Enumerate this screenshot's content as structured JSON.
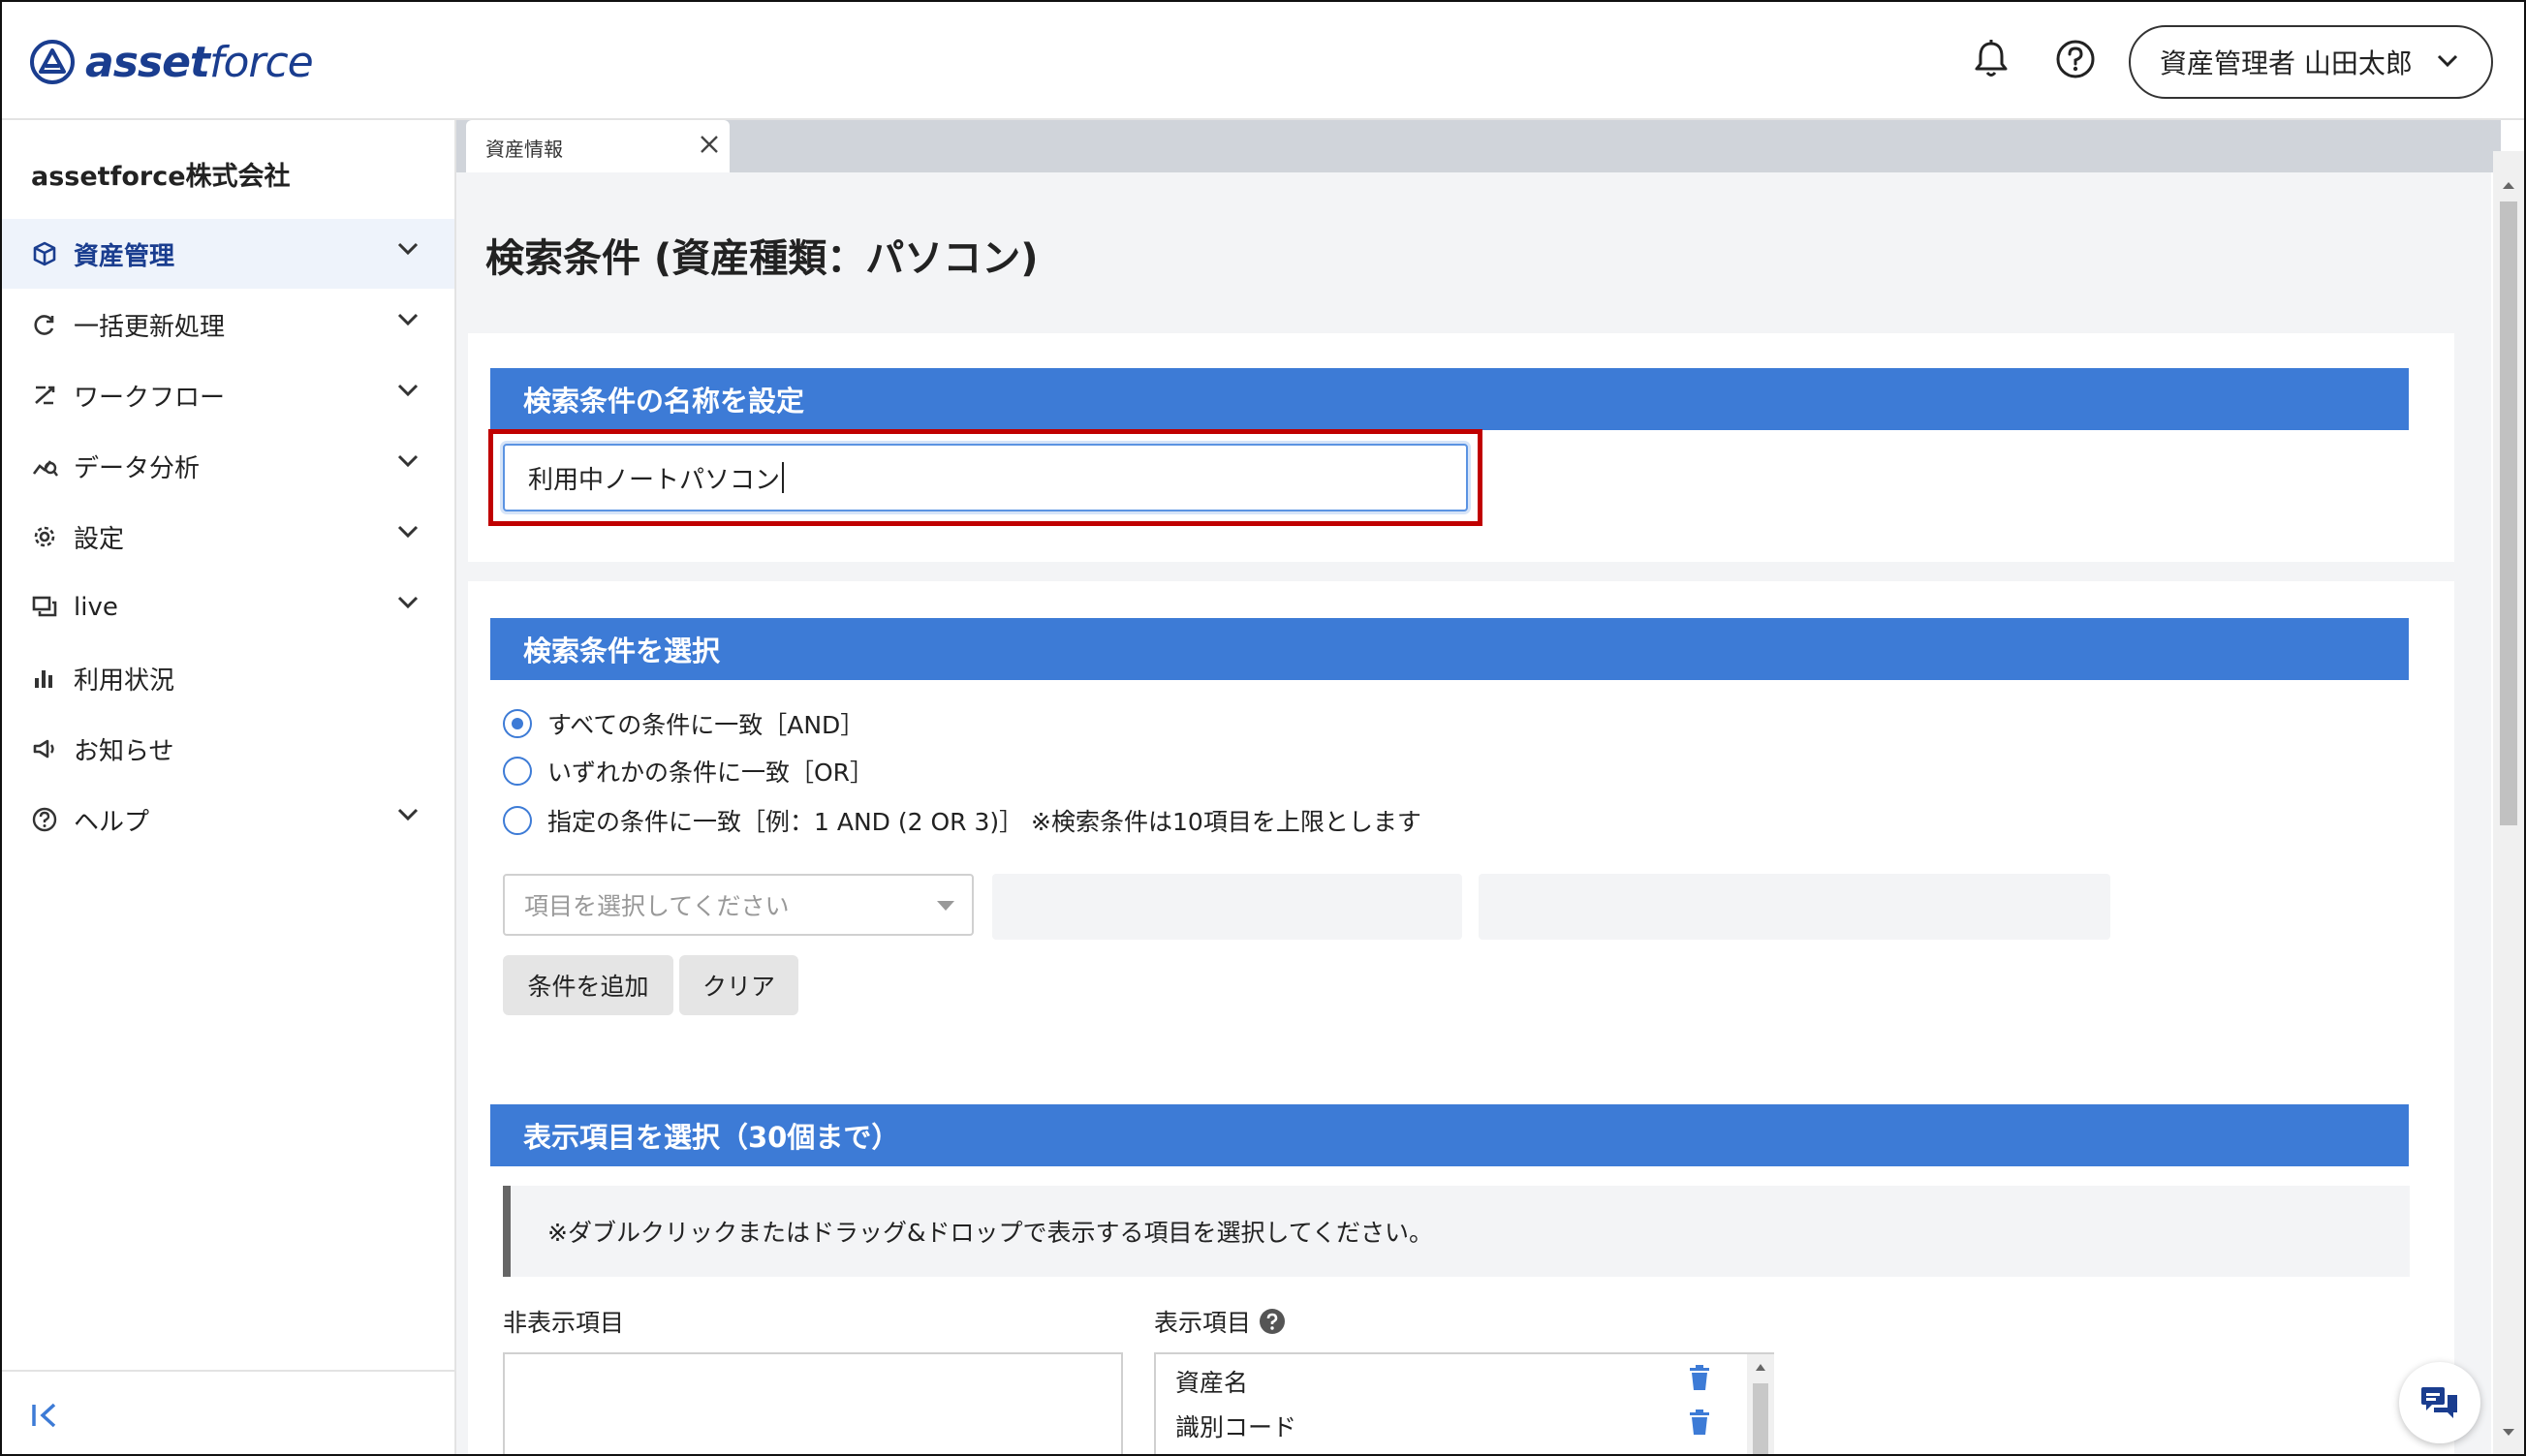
{
  "header": {
    "logo_bold": "asset",
    "logo_light": "force",
    "user_label": "資産管理者 山田太郎"
  },
  "sidebar": {
    "company": "assetforce株式会社",
    "items": [
      {
        "label": "資産管理",
        "icon": "cube-icon",
        "active": true,
        "has_chevron": true
      },
      {
        "label": "一括更新処理",
        "icon": "refresh-icon",
        "has_chevron": true
      },
      {
        "label": "ワークフロー",
        "icon": "workflow-icon",
        "has_chevron": true
      },
      {
        "label": "データ分析",
        "icon": "analytics-icon",
        "has_chevron": true
      },
      {
        "label": "設定",
        "icon": "gear-icon",
        "has_chevron": true
      },
      {
        "label": "live",
        "icon": "chat-icon",
        "has_chevron": true
      },
      {
        "label": "利用状況",
        "icon": "bar-chart-icon",
        "has_chevron": false
      },
      {
        "label": "お知らせ",
        "icon": "megaphone-icon",
        "has_chevron": false
      },
      {
        "label": "ヘルプ",
        "icon": "help-icon",
        "has_chevron": true
      }
    ]
  },
  "tab": {
    "label": "資産情報"
  },
  "page": {
    "title": "検索条件 (資産種類：パソコン)",
    "name_section": {
      "header": "検索条件の名称を設定",
      "value": "利用中ノートパソコン"
    },
    "condition_section": {
      "header": "検索条件を選択",
      "options": [
        {
          "label": "すべての条件に一致［AND］",
          "selected": true
        },
        {
          "label": "いずれかの条件に一致［OR］",
          "selected": false
        },
        {
          "label": "指定の条件に一致［例：1 AND (2 OR 3)］ ※検索条件は10項目を上限とします",
          "selected": false
        }
      ],
      "select_placeholder": "項目を選択してください",
      "add_button": "条件を追加",
      "clear_button": "クリア"
    },
    "display_section": {
      "header": "表示項目を選択（30個まで）",
      "note": "※ダブルクリックまたはドラッグ&ドロップで表示する項目を選択してください。",
      "hidden_label": "非表示項目",
      "shown_label": "表示項目",
      "shown_items": [
        "資産名",
        "識別コード"
      ]
    }
  },
  "colors": {
    "accent": "#3d7bd6",
    "brand": "#1a3d8f",
    "highlight": "#c00000"
  }
}
